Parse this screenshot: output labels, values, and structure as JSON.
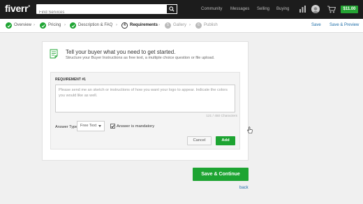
{
  "header": {
    "logo": "fiverr",
    "search_placeholder": "Find Services",
    "nav": [
      "Community",
      "Messages",
      "Selling",
      "Buying"
    ],
    "balance": "$11.00"
  },
  "steps": [
    {
      "label": "Overview",
      "state": "done"
    },
    {
      "label": "Pricing",
      "state": "done"
    },
    {
      "label": "Description & FAQ",
      "state": "done"
    },
    {
      "label": "Requirements",
      "number": "4",
      "state": "current"
    },
    {
      "label": "Gallery",
      "number": "5",
      "state": "todo"
    },
    {
      "label": "Publish",
      "number": "6",
      "state": "todo"
    }
  ],
  "actions": {
    "save": "Save",
    "save_preview": "Save & Preview"
  },
  "panel": {
    "title": "Tell your buyer what you need to get started.",
    "subtitle": "Structure your Buyer Instructions as free text, a multiple choice question or file upload.",
    "requirement_label": "REQUIREMENT #1",
    "requirement_text": "Please send me an sketch or instructions of how you want your logo to appear. Indicate the colors you would like as well.",
    "char_count": "121 / 450 Characters",
    "answer_type_label": "Answer Type",
    "answer_type_value": "Free Text",
    "mandatory_label": "Answer is mandatory",
    "mandatory_checked": true,
    "cancel_label": "Cancel",
    "add_label": "Add"
  },
  "footer": {
    "continue_label": "Save & Continue",
    "back_label": "back"
  },
  "colors": {
    "accent_green": "#1da432",
    "link_blue": "#1f6ea8",
    "topbar": "#1c1c1c"
  }
}
